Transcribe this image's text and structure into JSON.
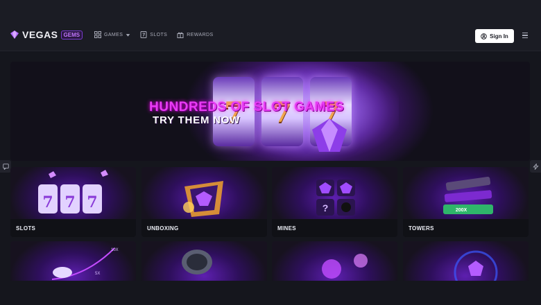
{
  "header": {
    "logo_text": "VEGAS",
    "logo_badge": "GEMS",
    "nav": [
      {
        "label": "GAMES",
        "icon": "grid-icon"
      },
      {
        "label": "SLOTS",
        "icon": "slot-seven-icon"
      },
      {
        "label": "REWARDS",
        "icon": "gift-icon"
      }
    ],
    "signin_label": "Sign In"
  },
  "hero": {
    "title": "HUNDREDS OF SLOT GAMES",
    "subtitle": "TRY THEM NOW",
    "reel_symbol": "7"
  },
  "games": [
    {
      "label": "SLOTS"
    },
    {
      "label": "UNBOXING"
    },
    {
      "label": "MINES"
    },
    {
      "label": "TOWERS"
    }
  ],
  "card_art_text": {
    "multiplier_10x": "10X",
    "multiplier_5x": "5X",
    "tower_200x": "200X"
  },
  "colors": {
    "accent": "#7a3bd0",
    "hero_title": "#e83cf5",
    "background": "#15161d"
  }
}
